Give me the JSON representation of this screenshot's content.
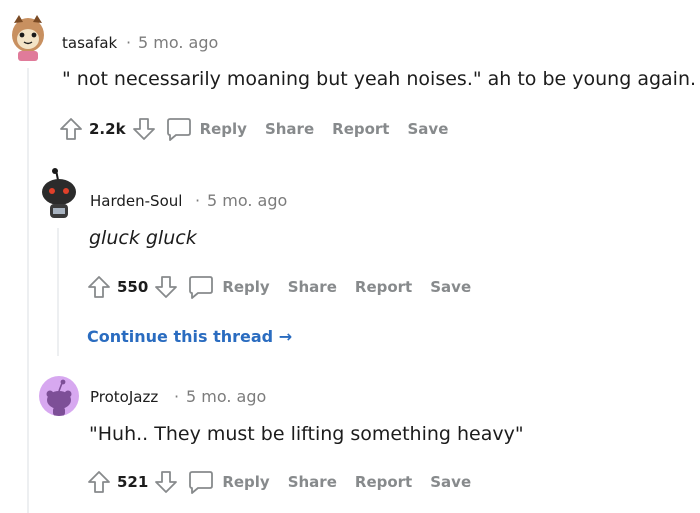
{
  "comments": [
    {
      "author": "tasafak",
      "separator": "·",
      "time": "5 mo. ago",
      "body": "\" not necessarily moaning but yeah noises.\" ah to be young again.",
      "votes": "2.2k",
      "actions": {
        "reply": "Reply",
        "share": "Share",
        "report": "Report",
        "save": "Save"
      }
    },
    {
      "author": "Harden-Soul",
      "separator": "·",
      "time": "5 mo. ago",
      "body": "gluck gluck",
      "votes": "550",
      "actions": {
        "reply": "Reply",
        "share": "Share",
        "report": "Report",
        "save": "Save"
      }
    },
    {
      "author": "ProtoJazz",
      "separator": "·",
      "time": "5 mo. ago",
      "body": "\"Huh.. They must be lifting something heavy\"",
      "votes": "521",
      "actions": {
        "reply": "Reply",
        "share": "Share",
        "report": "Report",
        "save": "Save"
      }
    }
  ],
  "continue_thread": "Continue this thread",
  "continue_arrow": "→",
  "colors": {
    "link": "#2a6cc0",
    "muted": "#878a8c",
    "thread_line": "#edeff1"
  }
}
